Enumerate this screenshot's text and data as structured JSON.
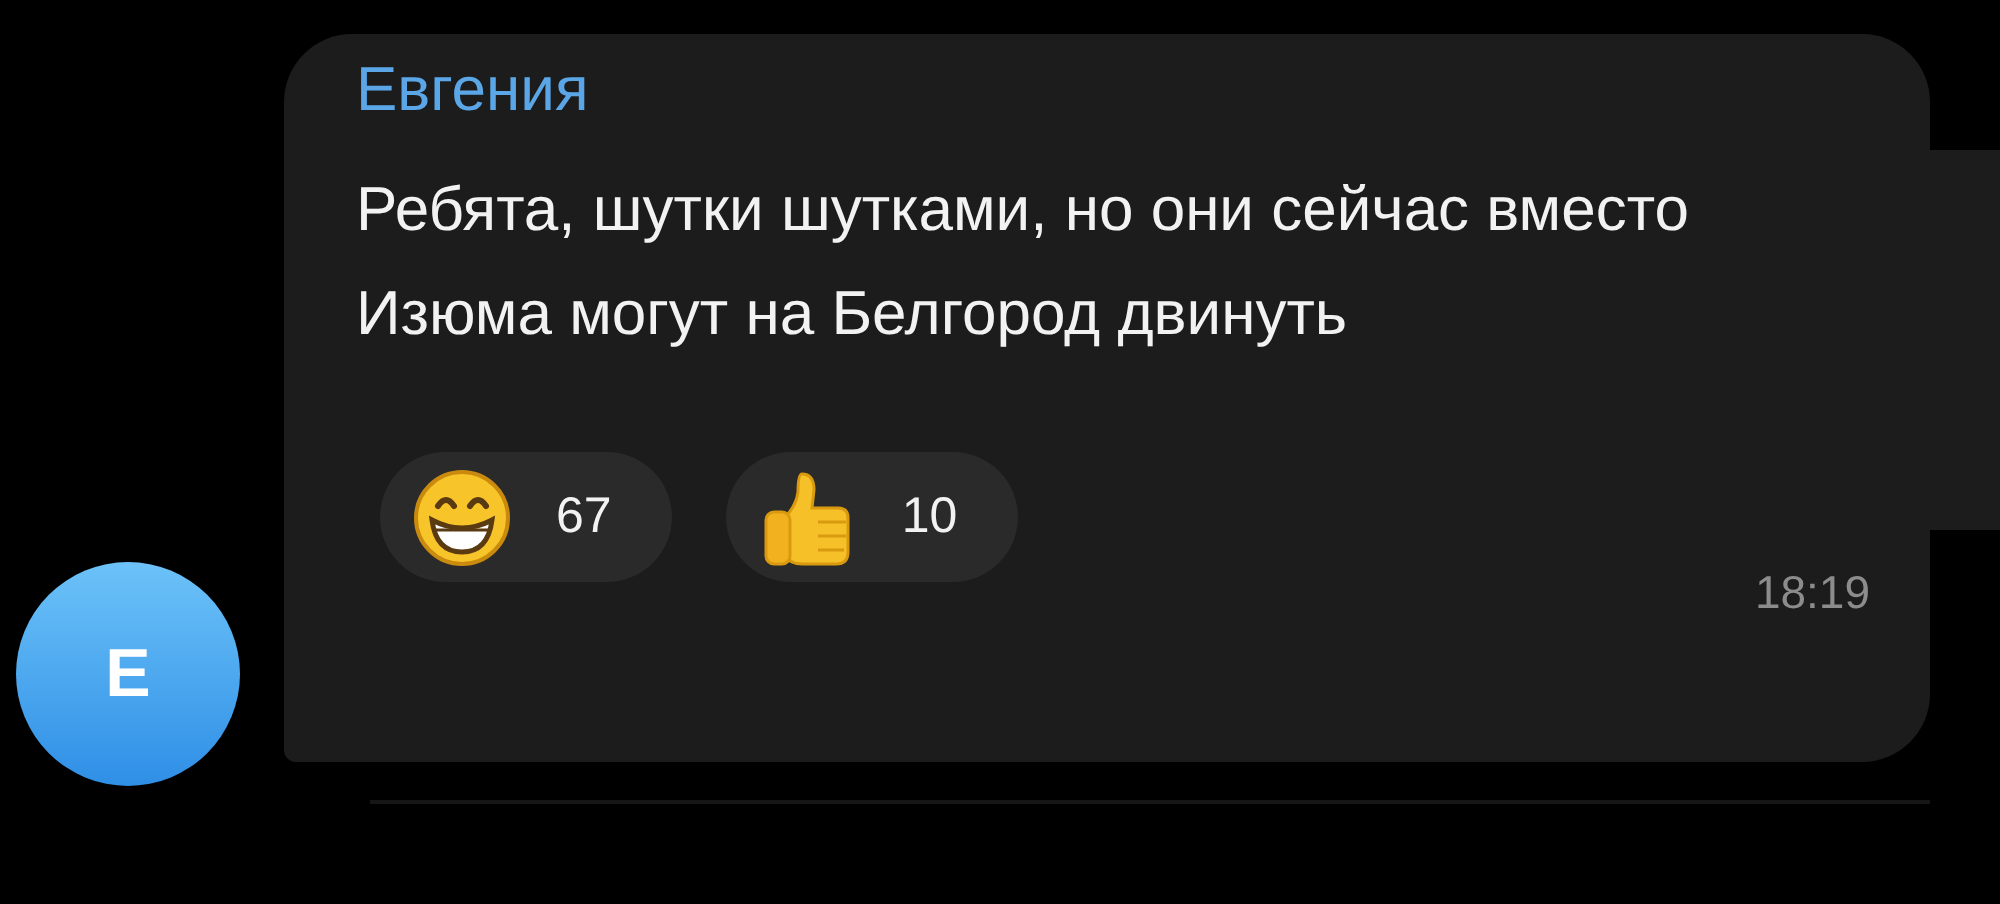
{
  "avatar": {
    "letter": "E"
  },
  "message": {
    "sender": "Евгения",
    "text": "Ребята, шутки шутками, но они сейчас вместо Изюма могут на Белгород двинуть",
    "reactions": [
      {
        "kind": "grin",
        "count": "67"
      },
      {
        "kind": "thumbs_up",
        "count": "10"
      }
    ],
    "time": "18:19"
  }
}
